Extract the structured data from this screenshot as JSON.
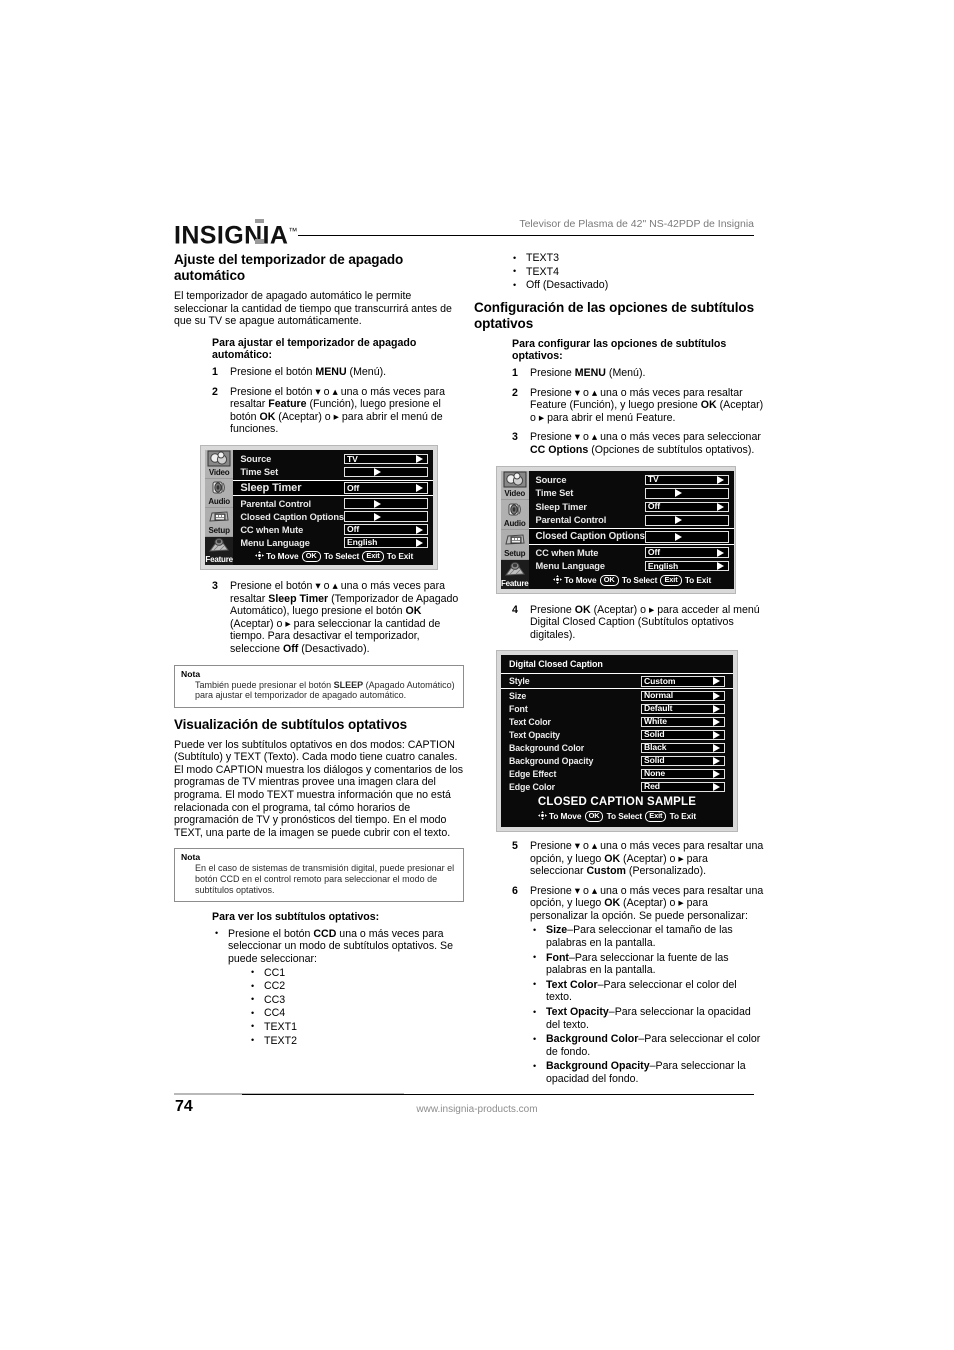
{
  "header": {
    "logo": "INSIGNIA",
    "logo_tm": "™",
    "title": "Televisor de Plasma de 42\" NS-42PDP de Insignia"
  },
  "footer": {
    "page_number": "74",
    "url": "www.insignia-products.com"
  },
  "left_column": {
    "section_title": "Ajuste del temporizador de apagado automático",
    "intro": "El temporizador de apagado automático le permite seleccionar la cantidad de tiempo que transcurrirá antes de que su TV se apague automáticamente.",
    "proc1_title": "Para ajustar el temporizador de apagado automático:",
    "steps": [
      {
        "num": "1",
        "html": "Presione el botón <b>MENU</b> (Menú)."
      },
      {
        "num": "2",
        "html": "Presione el botón ▾ o ▴ una o más veces para resaltar <b>Feature</b> (Función), luego presione el botón <b>OK</b> (Aceptar) o ▸ para abrir el menú de funciones."
      }
    ],
    "step3": {
      "num": "3",
      "html": "Presione el botón ▾ o ▴ una o más veces para resaltar <b>Sleep Timer</b> (Temporizador de Apagado Automático), luego presione el botón <b>OK</b> (Aceptar) o ▸ para seleccionar la cantidad de tiempo. Para desactivar el temporizador, seleccione <b>Off</b> (Desactivado)."
    },
    "note1": {
      "title": "Nota",
      "html": "También puede presionar el botón <b>SLEEP</b> (Apagado Automático) para ajustar el temporizador de apagado automático."
    },
    "section_title2": "Visualización de subtítulos optativos",
    "intro2": "Puede ver los subtítulos optativos en dos modos: CAPTION (Subtítulo) y TEXT (Texto). Cada modo tiene cuatro canales. El modo CAPTION muestra los diálogos y comentarios de los programas de TV mientras provee una imagen clara del programa. El modo TEXT muestra información que no está relacionada con el programa, tal cómo horarios de programación de TV y pronósticos del tiempo. En el modo TEXT, una parte de la imagen se puede cubrir con el texto.",
    "note2": {
      "title": "Nota",
      "html": "En el caso de sistemas de transmisión digital, puede presionar el botón CCD en el control remoto para seleccionar el modo de subtítulos optativos."
    },
    "proc2_title": "Para ver los subtítulos optativos:",
    "proc2_bullet": "Presione el botón <b>CCD</b> una o más veces para seleccionar un modo de subtítulos optativos. Se puede seleccionar:",
    "cc_modes": [
      "CC1",
      "CC2",
      "CC3",
      "CC4",
      "TEXT1",
      "TEXT2"
    ]
  },
  "right_column": {
    "cc_modes_cont": [
      "TEXT3",
      "TEXT4",
      "Off (Desactivado)"
    ],
    "section_title": "Configuración de las opciones de subtítulos optativos",
    "proc_title": "Para configurar las opciones de subtítulos optativos:",
    "steps": [
      {
        "num": "1",
        "html": "Presione <b>MENU</b> (Menú)."
      },
      {
        "num": "2",
        "html": "Presione ▾ o ▴ una o más veces para resaltar Feature (Función), y luego presione <b>OK</b> (Aceptar) o ▸ para abrir el menú Feature."
      },
      {
        "num": "3",
        "html": "Presione ▾ o ▴ una o más veces para seleccionar <b>CC Options</b> (Opciones de subtítulos optativos)."
      }
    ],
    "step4": {
      "num": "4",
      "html": "Presione <b>OK</b> (Aceptar) o ▸ para acceder al menú Digital Closed Caption (Subtítulos optativos digitales)."
    },
    "steps56": [
      {
        "num": "5",
        "html": "Presione ▾ o ▴ una o más veces para resaltar una opción, y luego <b>OK</b> (Aceptar) o ▸ para seleccionar <b>Custom</b> (Personalizado)."
      },
      {
        "num": "6",
        "html": "Presione ▾ o ▴ una o más veces para resaltar una opción, y luego <b>OK</b> (Aceptar) o ▸ para personalizar la opción. Se puede personalizar:"
      }
    ],
    "custom_options": [
      {
        "term": "Size",
        "desc": "–Para seleccionar el tamaño de las palabras en la pantalla."
      },
      {
        "term": "Font",
        "desc": "–Para seleccionar la fuente de las palabras en la pantalla."
      },
      {
        "term": "Text Color",
        "desc": "–Para seleccionar el color del texto."
      },
      {
        "term": "Text Opacity",
        "desc": "–Para seleccionar la opacidad del texto."
      },
      {
        "term": "Background Color",
        "desc": "–Para seleccionar el color de fondo."
      },
      {
        "term": "Background Opacity",
        "desc": "–Para seleccionar la opacidad del fondo."
      }
    ]
  },
  "osd_menu_1": {
    "sidebar": [
      "Video",
      "Audio",
      "Setup",
      "Feature"
    ],
    "rows": [
      {
        "label": "Source",
        "value": "TV",
        "highlighted": false,
        "has_value": true
      },
      {
        "label": "Time Set",
        "value": "",
        "highlighted": false,
        "has_value": true
      },
      {
        "label": "Sleep Timer",
        "value": "Off",
        "highlighted": true,
        "has_value": true
      },
      {
        "label": "Parental Control",
        "value": "",
        "highlighted": false,
        "has_value": true
      },
      {
        "label": "Closed Caption Options",
        "value": "",
        "highlighted": false,
        "has_value": true
      },
      {
        "label": "CC when Mute",
        "value": "Off",
        "highlighted": false,
        "has_value": true
      },
      {
        "label": "Menu Language",
        "value": "English",
        "highlighted": false,
        "has_value": true
      }
    ],
    "hint": {
      "move": "To Move",
      "ok": "OK",
      "select": "To Select",
      "exit_key": "Exit",
      "exit": "To Exit"
    }
  },
  "osd_menu_2": {
    "sidebar": [
      "Video",
      "Audio",
      "Setup",
      "Feature"
    ],
    "rows": [
      {
        "label": "Source",
        "value": "TV",
        "highlighted": false,
        "has_value": true
      },
      {
        "label": "Time Set",
        "value": "",
        "highlighted": false,
        "has_value": true
      },
      {
        "label": "Sleep Timer",
        "value": "Off",
        "highlighted": false,
        "has_value": true
      },
      {
        "label": "Parental Control",
        "value": "",
        "highlighted": false,
        "has_value": true
      },
      {
        "label": "Closed Caption Options",
        "value": "",
        "highlighted": true,
        "has_value": true
      },
      {
        "label": "CC when Mute",
        "value": "Off",
        "highlighted": false,
        "has_value": true
      },
      {
        "label": "Menu Language",
        "value": "English",
        "highlighted": false,
        "has_value": true
      }
    ],
    "hint": {
      "move": "To Move",
      "ok": "OK",
      "select": "To Select",
      "exit_key": "Exit",
      "exit": "To Exit"
    }
  },
  "dcc_menu": {
    "title": "Digital Closed Caption",
    "rows": [
      {
        "label": "Style",
        "value": "Custom",
        "highlighted": true
      },
      {
        "label": "Size",
        "value": "Normal",
        "highlighted": false
      },
      {
        "label": "Font",
        "value": "Default",
        "highlighted": false
      },
      {
        "label": "Text Color",
        "value": "White",
        "highlighted": false
      },
      {
        "label": "Text Opacity",
        "value": "Solid",
        "highlighted": false
      },
      {
        "label": "Background Color",
        "value": "Black",
        "highlighted": false
      },
      {
        "label": "Background Opacity",
        "value": "Solid",
        "highlighted": false
      },
      {
        "label": "Edge Effect",
        "value": "None",
        "highlighted": false
      },
      {
        "label": "Edge Color",
        "value": "Red",
        "highlighted": false
      }
    ],
    "sample_text": "CLOSED CAPTION SAMPLE",
    "hint": {
      "move": "To Move",
      "ok": "OK",
      "select": "To Select",
      "exit_key": "Exit",
      "exit": "To Exit"
    }
  },
  "colors": {
    "page_bg": "#ffffff",
    "text": "#000000",
    "header_title": "#7a7a7a",
    "osd_bg": "#0a0a0a",
    "osd_sidebar": "#b0b0b0",
    "osd_text": "#ffffff",
    "note_border": "#8d8d8d",
    "footer_url": "#8d8d8d"
  }
}
